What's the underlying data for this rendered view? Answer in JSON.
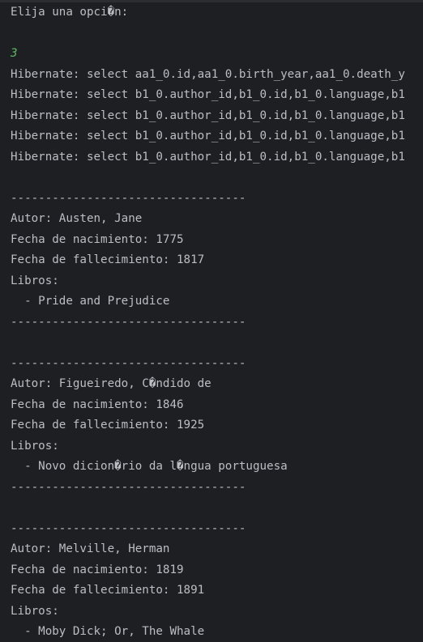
{
  "console": {
    "lines": [
      {
        "text": "Elija una opci�n:",
        "type": "output"
      },
      {
        "text": "",
        "type": "blank"
      },
      {
        "text": "3",
        "type": "input"
      },
      {
        "text": "Hibernate: select aa1_0.id,aa1_0.birth_year,aa1_0.death_y",
        "type": "output"
      },
      {
        "text": "Hibernate: select b1_0.author_id,b1_0.id,b1_0.language,b1",
        "type": "output"
      },
      {
        "text": "Hibernate: select b1_0.author_id,b1_0.id,b1_0.language,b1",
        "type": "output"
      },
      {
        "text": "Hibernate: select b1_0.author_id,b1_0.id,b1_0.language,b1",
        "type": "output"
      },
      {
        "text": "Hibernate: select b1_0.author_id,b1_0.id,b1_0.language,b1",
        "type": "output"
      },
      {
        "text": "",
        "type": "blank"
      },
      {
        "text": "----------------------------------",
        "type": "output"
      },
      {
        "text": "Autor: Austen, Jane",
        "type": "output"
      },
      {
        "text": "Fecha de nacimiento: 1775",
        "type": "output"
      },
      {
        "text": "Fecha de fallecimiento: 1817",
        "type": "output"
      },
      {
        "text": "Libros:",
        "type": "output"
      },
      {
        "text": "  - Pride and Prejudice",
        "type": "output"
      },
      {
        "text": "----------------------------------",
        "type": "output"
      },
      {
        "text": "",
        "type": "blank"
      },
      {
        "text": "----------------------------------",
        "type": "output"
      },
      {
        "text": "Autor: Figueiredo, C�ndido de",
        "type": "output"
      },
      {
        "text": "Fecha de nacimiento: 1846",
        "type": "output"
      },
      {
        "text": "Fecha de fallecimiento: 1925",
        "type": "output"
      },
      {
        "text": "Libros:",
        "type": "output"
      },
      {
        "text": "  - Novo dicion�rio da l�ngua portuguesa",
        "type": "output"
      },
      {
        "text": "----------------------------------",
        "type": "output"
      },
      {
        "text": "",
        "type": "blank"
      },
      {
        "text": "----------------------------------",
        "type": "output"
      },
      {
        "text": "Autor: Melville, Herman",
        "type": "output"
      },
      {
        "text": "Fecha de nacimiento: 1819",
        "type": "output"
      },
      {
        "text": "Fecha de fallecimiento: 1891",
        "type": "output"
      },
      {
        "text": "Libros:",
        "type": "output"
      },
      {
        "text": "  - Moby Dick; Or, The Whale",
        "type": "output"
      }
    ]
  },
  "colors": {
    "background": "#1e1f22",
    "text": "#bcbec4",
    "user_input": "#5fb865"
  }
}
